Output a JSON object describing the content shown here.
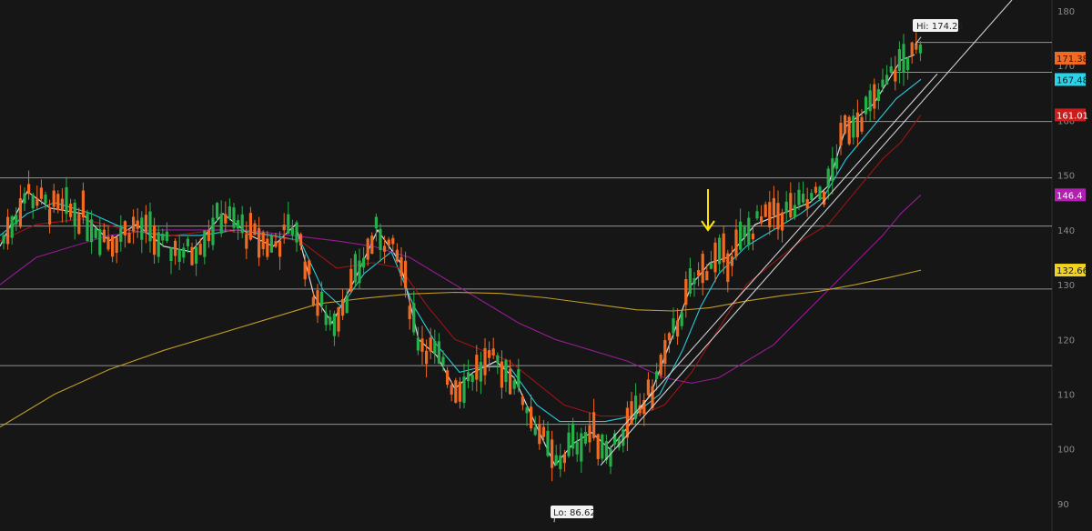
{
  "chart_data": {
    "type": "candlestick",
    "y_axis": {
      "min": 85,
      "max": 182,
      "ticks": [
        90,
        100,
        110,
        120,
        130,
        140,
        150,
        160,
        170,
        180
      ],
      "side": "right"
    },
    "horizontal_levels": [
      104.5,
      115.2,
      129.2,
      140.7,
      149.5,
      159.8,
      168.8,
      174.25
    ],
    "price_tags": [
      {
        "label": "171.38",
        "value": 171.38,
        "color": "#f26a21",
        "text_color": "#1a1a1a"
      },
      {
        "label": "167.48",
        "value": 167.48,
        "color": "#29d4e8",
        "text_color": "#1a1a1a"
      },
      {
        "label": "161.01",
        "value": 161.01,
        "color": "#d01b1b",
        "text_color": "#ffffff"
      },
      {
        "label": "146.4",
        "value": 146.4,
        "color": "#b21fb2",
        "text_color": "#ffffff"
      },
      {
        "label": "132.66",
        "value": 132.66,
        "color": "#f2d21c",
        "text_color": "#1a1a1a"
      }
    ],
    "callouts": {
      "high": {
        "label": "Hi: 174.25",
        "value": 174.25
      },
      "low": {
        "label": "Lo: 86.62",
        "value": 86.62
      }
    },
    "annotation_arrow": {
      "color": "#ffe600",
      "at_value": 135.5
    },
    "trendlines": [
      {
        "from": [
          660,
          97
        ],
        "to": [
          1112,
          182
        ],
        "unit": "bar-index-and-price"
      }
    ],
    "series": [
      {
        "name": "ma_fast",
        "color": "#e6e6e6",
        "values": [
          [
            0,
            137
          ],
          [
            30,
            147
          ],
          [
            55,
            144
          ],
          [
            90,
            143
          ],
          [
            120,
            138
          ],
          [
            150,
            141
          ],
          [
            180,
            137
          ],
          [
            210,
            136
          ],
          [
            245,
            143
          ],
          [
            275,
            139
          ],
          [
            300,
            137
          ],
          [
            325,
            141
          ],
          [
            345,
            128
          ],
          [
            365,
            123
          ],
          [
            390,
            131
          ],
          [
            415,
            140
          ],
          [
            440,
            134
          ],
          [
            460,
            120
          ],
          [
            480,
            117
          ],
          [
            500,
            111
          ],
          [
            520,
            114
          ],
          [
            545,
            116
          ],
          [
            565,
            113
          ],
          [
            590,
            104
          ],
          [
            610,
            97
          ],
          [
            630,
            101
          ],
          [
            650,
            103
          ],
          [
            670,
            100
          ],
          [
            690,
            104
          ],
          [
            715,
            110
          ],
          [
            740,
            121
          ],
          [
            760,
            130
          ],
          [
            780,
            134
          ],
          [
            800,
            135
          ],
          [
            830,
            141
          ],
          [
            860,
            143
          ],
          [
            890,
            145
          ],
          [
            910,
            148
          ],
          [
            930,
            159
          ],
          [
            960,
            163
          ],
          [
            990,
            171
          ],
          [
            1005,
            172
          ]
        ]
      },
      {
        "name": "ma_mid",
        "color": "#29d4e8",
        "values": [
          [
            0,
            139
          ],
          [
            30,
            143
          ],
          [
            60,
            145
          ],
          [
            100,
            143
          ],
          [
            140,
            140
          ],
          [
            180,
            139
          ],
          [
            220,
            139
          ],
          [
            260,
            140
          ],
          [
            300,
            139
          ],
          [
            330,
            138
          ],
          [
            355,
            129
          ],
          [
            375,
            126
          ],
          [
            400,
            132
          ],
          [
            430,
            136
          ],
          [
            455,
            126
          ],
          [
            480,
            119
          ],
          [
            505,
            114
          ],
          [
            530,
            115
          ],
          [
            560,
            115
          ],
          [
            590,
            108
          ],
          [
            615,
            105
          ],
          [
            640,
            105
          ],
          [
            665,
            105
          ],
          [
            695,
            106
          ],
          [
            725,
            110
          ],
          [
            750,
            118
          ],
          [
            770,
            126
          ],
          [
            790,
            132
          ],
          [
            820,
            137
          ],
          [
            850,
            140
          ],
          [
            880,
            143
          ],
          [
            905,
            146
          ],
          [
            930,
            153
          ],
          [
            960,
            159
          ],
          [
            985,
            164
          ],
          [
            1012,
            167.5
          ]
        ]
      },
      {
        "name": "ma_red",
        "color": "#a31414",
        "values": [
          [
            0,
            138
          ],
          [
            40,
            141
          ],
          [
            90,
            142
          ],
          [
            140,
            140
          ],
          [
            190,
            139
          ],
          [
            240,
            140
          ],
          [
            290,
            139
          ],
          [
            330,
            138
          ],
          [
            370,
            133
          ],
          [
            410,
            134
          ],
          [
            440,
            133
          ],
          [
            470,
            126
          ],
          [
            500,
            120
          ],
          [
            530,
            118
          ],
          [
            560,
            116
          ],
          [
            590,
            112
          ],
          [
            620,
            108
          ],
          [
            660,
            106
          ],
          [
            700,
            106
          ],
          [
            730,
            108
          ],
          [
            760,
            114
          ],
          [
            790,
            122
          ],
          [
            820,
            130
          ],
          [
            850,
            134
          ],
          [
            880,
            138
          ],
          [
            910,
            141
          ],
          [
            940,
            147
          ],
          [
            970,
            153
          ],
          [
            990,
            156
          ],
          [
            1012,
            161
          ]
        ]
      },
      {
        "name": "ma_purple",
        "color": "#9b1c9b",
        "values": [
          [
            0,
            130
          ],
          [
            40,
            135
          ],
          [
            80,
            137
          ],
          [
            120,
            139
          ],
          [
            170,
            140
          ],
          [
            220,
            140
          ],
          [
            270,
            140
          ],
          [
            320,
            139
          ],
          [
            370,
            138
          ],
          [
            410,
            137
          ],
          [
            450,
            135
          ],
          [
            490,
            131
          ],
          [
            530,
            127
          ],
          [
            570,
            123
          ],
          [
            610,
            120
          ],
          [
            650,
            118
          ],
          [
            690,
            116
          ],
          [
            730,
            113
          ],
          [
            760,
            112
          ],
          [
            790,
            113
          ],
          [
            820,
            116
          ],
          [
            850,
            119
          ],
          [
            880,
            124
          ],
          [
            910,
            129
          ],
          [
            940,
            134
          ],
          [
            970,
            139
          ],
          [
            990,
            143
          ],
          [
            1012,
            146.4
          ]
        ]
      },
      {
        "name": "ma_yellow",
        "color": "#c9a227",
        "values": [
          [
            0,
            104
          ],
          [
            60,
            110
          ],
          [
            120,
            114.5
          ],
          [
            180,
            118
          ],
          [
            240,
            121
          ],
          [
            300,
            124
          ],
          [
            350,
            126.5
          ],
          [
            400,
            127.5
          ],
          [
            450,
            128.3
          ],
          [
            500,
            128.6
          ],
          [
            550,
            128.4
          ],
          [
            600,
            127.6
          ],
          [
            650,
            126.5
          ],
          [
            700,
            125.4
          ],
          [
            740,
            125.2
          ],
          [
            780,
            125.8
          ],
          [
            820,
            127
          ],
          [
            860,
            128
          ],
          [
            900,
            128.8
          ],
          [
            940,
            130
          ],
          [
            980,
            131.4
          ],
          [
            1012,
            132.66
          ]
        ]
      }
    ]
  }
}
